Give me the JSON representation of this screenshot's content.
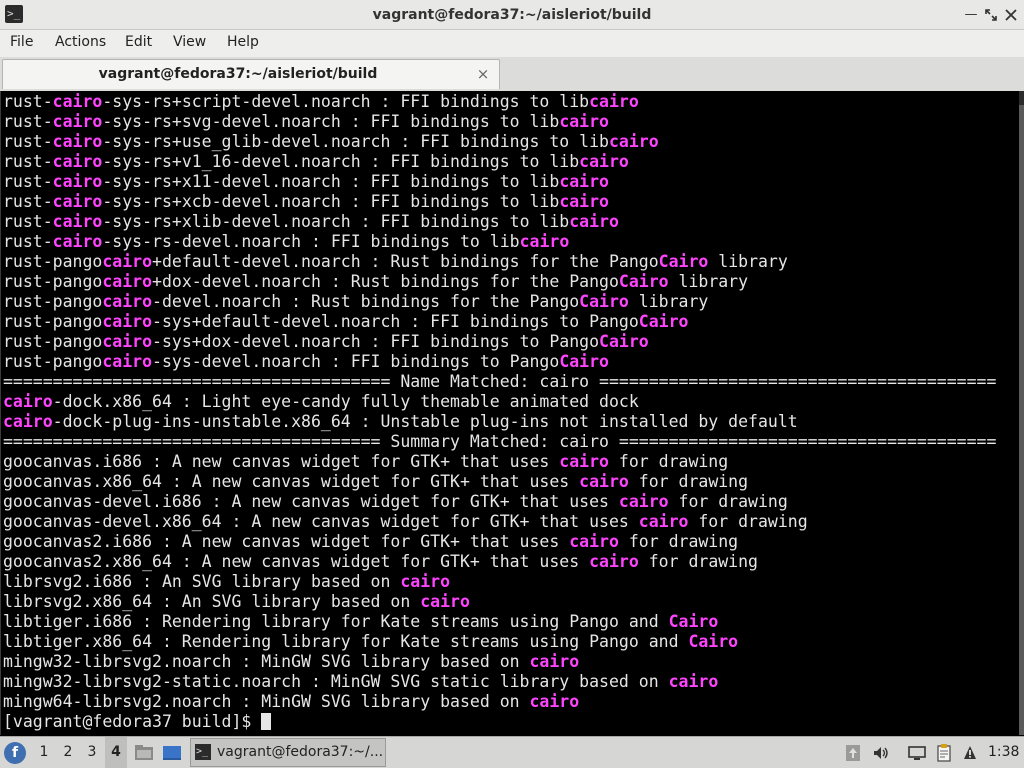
{
  "window": {
    "title": "vagrant@fedora37:~/aisleriot/build",
    "controls": [
      "minimize-icon",
      "maximize-icon",
      "close-icon"
    ]
  },
  "menubar": {
    "items": [
      "File",
      "Actions",
      "Edit",
      "View",
      "Help"
    ]
  },
  "tabs": [
    {
      "label": "vagrant@fedora37:~/aisleriot/build",
      "close": "×"
    }
  ],
  "terminal": {
    "highlight_color": "#ff44ff",
    "lines": [
      [
        [
          "rust-",
          false
        ],
        [
          "cairo",
          true
        ],
        [
          "-sys-rs+script-devel.noarch : FFI bindings to lib",
          false
        ],
        [
          "cairo",
          true
        ]
      ],
      [
        [
          "rust-",
          false
        ],
        [
          "cairo",
          true
        ],
        [
          "-sys-rs+svg-devel.noarch : FFI bindings to lib",
          false
        ],
        [
          "cairo",
          true
        ]
      ],
      [
        [
          "rust-",
          false
        ],
        [
          "cairo",
          true
        ],
        [
          "-sys-rs+use_glib-devel.noarch : FFI bindings to lib",
          false
        ],
        [
          "cairo",
          true
        ]
      ],
      [
        [
          "rust-",
          false
        ],
        [
          "cairo",
          true
        ],
        [
          "-sys-rs+v1_16-devel.noarch : FFI bindings to lib",
          false
        ],
        [
          "cairo",
          true
        ]
      ],
      [
        [
          "rust-",
          false
        ],
        [
          "cairo",
          true
        ],
        [
          "-sys-rs+x11-devel.noarch : FFI bindings to lib",
          false
        ],
        [
          "cairo",
          true
        ]
      ],
      [
        [
          "rust-",
          false
        ],
        [
          "cairo",
          true
        ],
        [
          "-sys-rs+xcb-devel.noarch : FFI bindings to lib",
          false
        ],
        [
          "cairo",
          true
        ]
      ],
      [
        [
          "rust-",
          false
        ],
        [
          "cairo",
          true
        ],
        [
          "-sys-rs+xlib-devel.noarch : FFI bindings to lib",
          false
        ],
        [
          "cairo",
          true
        ]
      ],
      [
        [
          "rust-",
          false
        ],
        [
          "cairo",
          true
        ],
        [
          "-sys-rs-devel.noarch : FFI bindings to lib",
          false
        ],
        [
          "cairo",
          true
        ]
      ],
      [
        [
          "rust-pango",
          false
        ],
        [
          "cairo",
          true
        ],
        [
          "+default-devel.noarch : Rust bindings for the Pango",
          false
        ],
        [
          "Cairo",
          true
        ],
        [
          " library",
          false
        ]
      ],
      [
        [
          "rust-pango",
          false
        ],
        [
          "cairo",
          true
        ],
        [
          "+dox-devel.noarch : Rust bindings for the Pango",
          false
        ],
        [
          "Cairo",
          true
        ],
        [
          " library",
          false
        ]
      ],
      [
        [
          "rust-pango",
          false
        ],
        [
          "cairo",
          true
        ],
        [
          "-devel.noarch : Rust bindings for the Pango",
          false
        ],
        [
          "Cairo",
          true
        ],
        [
          " library",
          false
        ]
      ],
      [
        [
          "rust-pango",
          false
        ],
        [
          "cairo",
          true
        ],
        [
          "-sys+default-devel.noarch : FFI bindings to Pango",
          false
        ],
        [
          "Cairo",
          true
        ]
      ],
      [
        [
          "rust-pango",
          false
        ],
        [
          "cairo",
          true
        ],
        [
          "-sys+dox-devel.noarch : FFI bindings to Pango",
          false
        ],
        [
          "Cairo",
          true
        ]
      ],
      [
        [
          "rust-pango",
          false
        ],
        [
          "cairo",
          true
        ],
        [
          "-sys-devel.noarch : FFI bindings to Pango",
          false
        ],
        [
          "Cairo",
          true
        ]
      ],
      [
        [
          "======================================= Name Matched: cairo ========================================",
          false
        ]
      ],
      [
        [
          "cairo",
          true
        ],
        [
          "-dock.x86_64 : Light eye-candy fully themable animated dock",
          false
        ]
      ],
      [
        [
          "cairo",
          true
        ],
        [
          "-dock-plug-ins-unstable.x86_64 : Unstable plug-ins not installed by default",
          false
        ]
      ],
      [
        [
          "====================================== Summary Matched: cairo ======================================",
          false
        ]
      ],
      [
        [
          "goocanvas.i686 : A new canvas widget for GTK+ that uses ",
          false
        ],
        [
          "cairo",
          true
        ],
        [
          " for drawing",
          false
        ]
      ],
      [
        [
          "goocanvas.x86_64 : A new canvas widget for GTK+ that uses ",
          false
        ],
        [
          "cairo",
          true
        ],
        [
          " for drawing",
          false
        ]
      ],
      [
        [
          "goocanvas-devel.i686 : A new canvas widget for GTK+ that uses ",
          false
        ],
        [
          "cairo",
          true
        ],
        [
          " for drawing",
          false
        ]
      ],
      [
        [
          "goocanvas-devel.x86_64 : A new canvas widget for GTK+ that uses ",
          false
        ],
        [
          "cairo",
          true
        ],
        [
          " for drawing",
          false
        ]
      ],
      [
        [
          "goocanvas2.i686 : A new canvas widget for GTK+ that uses ",
          false
        ],
        [
          "cairo",
          true
        ],
        [
          " for drawing",
          false
        ]
      ],
      [
        [
          "goocanvas2.x86_64 : A new canvas widget for GTK+ that uses ",
          false
        ],
        [
          "cairo",
          true
        ],
        [
          " for drawing",
          false
        ]
      ],
      [
        [
          "librsvg2.i686 : An SVG library based on ",
          false
        ],
        [
          "cairo",
          true
        ]
      ],
      [
        [
          "librsvg2.x86_64 : An SVG library based on ",
          false
        ],
        [
          "cairo",
          true
        ]
      ],
      [
        [
          "libtiger.i686 : Rendering library for Kate streams using Pango and ",
          false
        ],
        [
          "Cairo",
          true
        ]
      ],
      [
        [
          "libtiger.x86_64 : Rendering library for Kate streams using Pango and ",
          false
        ],
        [
          "Cairo",
          true
        ]
      ],
      [
        [
          "mingw32-librsvg2.noarch : MinGW SVG library based on ",
          false
        ],
        [
          "cairo",
          true
        ]
      ],
      [
        [
          "mingw32-librsvg2-static.noarch : MinGW SVG static library based on ",
          false
        ],
        [
          "cairo",
          true
        ]
      ],
      [
        [
          "mingw64-librsvg2.noarch : MinGW SVG library based on ",
          false
        ],
        [
          "cairo",
          true
        ]
      ]
    ],
    "prompt": "[vagrant@fedora37 build]$ "
  },
  "taskbar": {
    "start_icon": "fedora-menu-icon",
    "workspaces": [
      {
        "label": "1",
        "active": false
      },
      {
        "label": "2",
        "active": false
      },
      {
        "label": "3",
        "active": false
      },
      {
        "label": "4",
        "active": true
      }
    ],
    "launchers": [
      "file-manager-icon",
      "desktop-icon"
    ],
    "task": {
      "label": "vagrant@fedora37:~/...",
      "icon": "terminal-icon"
    },
    "tray": [
      "updates-icon",
      "volume-icon",
      "network-icon",
      "clipboard-icon",
      "notification-icon"
    ],
    "clock": "1:38"
  }
}
